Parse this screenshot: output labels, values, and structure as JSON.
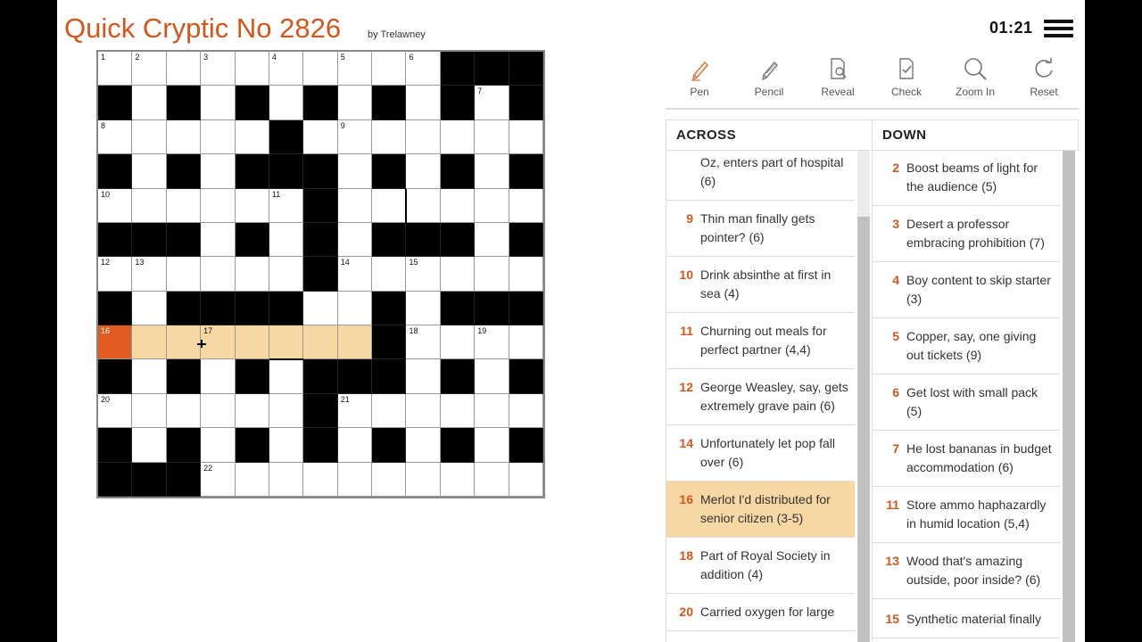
{
  "header": {
    "title": "Quick Cryptic No 2826",
    "byline": "by Trelawney",
    "timer": "01:21",
    "menu_icon": "hamburger-menu-icon"
  },
  "colors": {
    "accent": "#d4561d",
    "highlight": "#f7d7a4",
    "selected_cell": "#e05b22",
    "black_cell": "#000000"
  },
  "grid": {
    "size": 13,
    "rows": [
      "..........###",
      "#.#.#.#.#.#.#",
      ".....#.......",
      "#.#.###.#.#.#",
      "......#......",
      "###.#.#.###.#",
      "......#......",
      "#.####..#.###",
      "........#....",
      "#.#.#.###.#.#",
      "......#......",
      "#.#.#.#.#.#.#",
      "###.........."
    ],
    "numbers": [
      {
        "r": 0,
        "c": 0,
        "n": "1"
      },
      {
        "r": 0,
        "c": 1,
        "n": "2"
      },
      {
        "r": 0,
        "c": 3,
        "n": "3"
      },
      {
        "r": 0,
        "c": 5,
        "n": "4"
      },
      {
        "r": 0,
        "c": 7,
        "n": "5"
      },
      {
        "r": 0,
        "c": 9,
        "n": "6"
      },
      {
        "r": 1,
        "c": 11,
        "n": "7"
      },
      {
        "r": 2,
        "c": 0,
        "n": "8"
      },
      {
        "r": 2,
        "c": 7,
        "n": "9"
      },
      {
        "r": 4,
        "c": 0,
        "n": "10"
      },
      {
        "r": 4,
        "c": 5,
        "n": "11"
      },
      {
        "r": 6,
        "c": 0,
        "n": "12"
      },
      {
        "r": 6,
        "c": 1,
        "n": "13"
      },
      {
        "r": 6,
        "c": 7,
        "n": "14"
      },
      {
        "r": 6,
        "c": 9,
        "n": "15"
      },
      {
        "r": 8,
        "c": 0,
        "n": "16"
      },
      {
        "r": 8,
        "c": 3,
        "n": "17"
      },
      {
        "r": 8,
        "c": 9,
        "n": "18"
      },
      {
        "r": 8,
        "c": 11,
        "n": "19"
      },
      {
        "r": 10,
        "c": 0,
        "n": "20"
      },
      {
        "r": 10,
        "c": 7,
        "n": "21"
      },
      {
        "r": 12,
        "c": 3,
        "n": "22"
      }
    ],
    "highlight_row": 8,
    "highlight_from": 0,
    "highlight_to": 7,
    "selected": {
      "r": 8,
      "c": 0
    }
  },
  "toolbar": [
    {
      "label": "Pen",
      "icon": "pen-icon"
    },
    {
      "label": "Pencil",
      "icon": "pencil-icon"
    },
    {
      "label": "Reveal",
      "icon": "reveal-icon"
    },
    {
      "label": "Check",
      "icon": "check-icon"
    },
    {
      "label": "Zoom In",
      "icon": "zoom-in-icon"
    },
    {
      "label": "Reset",
      "icon": "reset-icon"
    }
  ],
  "across": {
    "heading": "ACROSS",
    "clues": [
      {
        "num": "",
        "text": "Oz, enters part of hospital (6)"
      },
      {
        "num": "9",
        "text": "Thin man finally gets pointer? (6)"
      },
      {
        "num": "10",
        "text": "Drink absinthe at first in sea (4)"
      },
      {
        "num": "11",
        "text": "Churning out meals for perfect partner (4,4)"
      },
      {
        "num": "12",
        "text": "George Weasley, say, gets extremely grave pain (6)"
      },
      {
        "num": "14",
        "text": "Unfortunately let pop fall over (6)"
      },
      {
        "num": "16",
        "text": "Merlot I'd distributed for senior citizen (3-5)",
        "active": true
      },
      {
        "num": "18",
        "text": "Part of Royal Society in addition (4)"
      },
      {
        "num": "20",
        "text": "Carried oxygen for large"
      }
    ]
  },
  "down": {
    "heading": "DOWN",
    "clues": [
      {
        "num": "2",
        "text": "Boost beams of light for the audience (5)"
      },
      {
        "num": "3",
        "text": "Desert a professor embracing prohibition (7)"
      },
      {
        "num": "4",
        "text": "Boy content to skip starter (3)"
      },
      {
        "num": "5",
        "text": "Copper, say, one giving out tickets (9)"
      },
      {
        "num": "6",
        "text": "Get lost with small pack (5)"
      },
      {
        "num": "7",
        "text": "He lost bananas in budget accommodation (6)"
      },
      {
        "num": "11",
        "text": "Store ammo haphazardly in humid location (5,4)"
      },
      {
        "num": "13",
        "text": "Wood that's amazing outside, poor inside? (6)"
      },
      {
        "num": "15",
        "text": "Synthetic material finally"
      }
    ]
  }
}
